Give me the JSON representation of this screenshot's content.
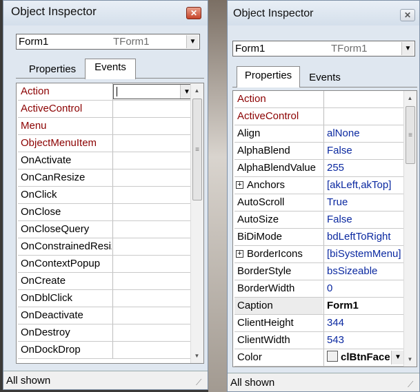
{
  "left": {
    "title": "Object Inspector",
    "close_glyph": "✕",
    "combo": {
      "name": "Form1",
      "class": "TForm1",
      "arrow": "▼"
    },
    "tabs": [
      {
        "label": "Properties"
      },
      {
        "label": "Events"
      }
    ],
    "active_tab": "Events",
    "rows": [
      {
        "name": "Action",
        "kind": "event",
        "editor": true,
        "editor_arrow": "▼"
      },
      {
        "name": "ActiveControl",
        "kind": "event"
      },
      {
        "name": "Menu",
        "kind": "event"
      },
      {
        "name": "ObjectMenuItem",
        "kind": "event"
      },
      {
        "name": "OnActivate"
      },
      {
        "name": "OnCanResize"
      },
      {
        "name": "OnClick"
      },
      {
        "name": "OnClose"
      },
      {
        "name": "OnCloseQuery"
      },
      {
        "name": "OnConstrainedResize"
      },
      {
        "name": "OnContextPopup"
      },
      {
        "name": "OnCreate"
      },
      {
        "name": "OnDblClick"
      },
      {
        "name": "OnDeactivate"
      },
      {
        "name": "OnDestroy"
      },
      {
        "name": "OnDockDrop"
      }
    ],
    "scroll": {
      "up": "▲",
      "down": "▼",
      "grip": "≡"
    },
    "status": "All shown",
    "grip_glyph": "⟋"
  },
  "right": {
    "title": "Object Inspector",
    "close_glyph": "✕",
    "combo": {
      "name": "Form1",
      "class": "TForm1",
      "arrow": "▼"
    },
    "tabs": [
      {
        "label": "Properties"
      },
      {
        "label": "Events"
      }
    ],
    "active_tab": "Properties",
    "rows": [
      {
        "name": "Action",
        "kind": "event",
        "value": ""
      },
      {
        "name": "ActiveControl",
        "kind": "event",
        "value": ""
      },
      {
        "name": "Align",
        "value": "alNone"
      },
      {
        "name": "AlphaBlend",
        "value": "False"
      },
      {
        "name": "AlphaBlendValue",
        "value": "255"
      },
      {
        "name": "Anchors",
        "value": "[akLeft,akTop]",
        "expander": "+"
      },
      {
        "name": "AutoScroll",
        "value": "True"
      },
      {
        "name": "AutoSize",
        "value": "False"
      },
      {
        "name": "BiDiMode",
        "value": "bdLeftToRight"
      },
      {
        "name": "BorderIcons",
        "value": "[biSystemMenu]",
        "expander": "+"
      },
      {
        "name": "BorderStyle",
        "value": "bsSizeable"
      },
      {
        "name": "BorderWidth",
        "value": "0"
      },
      {
        "name": "Caption",
        "value": "Form1",
        "selected": true
      },
      {
        "name": "ClientHeight",
        "value": "344"
      },
      {
        "name": "ClientWidth",
        "value": "543"
      },
      {
        "name": "Color",
        "value": "clBtnFace",
        "swatch": true,
        "selected_value_style": true,
        "editor_arrow": "▼"
      }
    ],
    "scroll": {
      "up": "▲",
      "down": "▼",
      "grip": "≡"
    },
    "status": "All shown",
    "grip_glyph": "⟋"
  }
}
